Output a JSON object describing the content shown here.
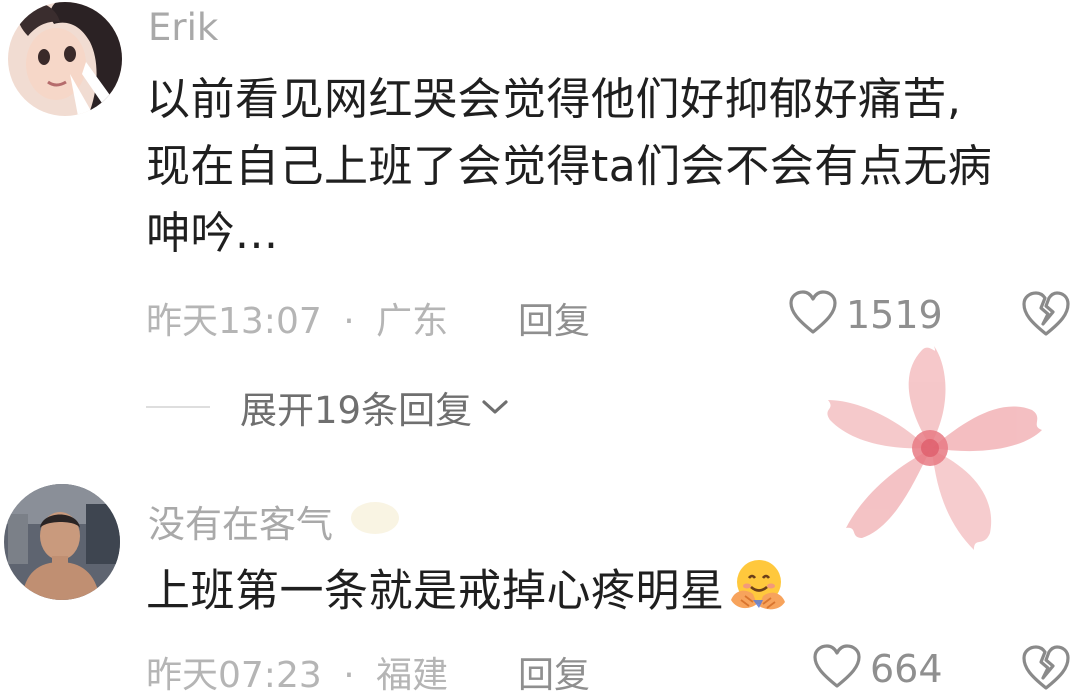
{
  "comments": [
    {
      "username": "Erik",
      "body_lines": [
        "以前看见网红哭会觉得他们好抑郁好痛苦,",
        "现在自己上班了会觉得ta们会不会有点无病",
        "呻吟..."
      ],
      "time": "昨天13:07",
      "separator": "·",
      "location": "广东",
      "reply_label": "回复",
      "likes": "1519"
    },
    {
      "username": "没有在客气",
      "body_lines": [
        "上班第一条就是戒掉心疼明星"
      ],
      "time": "昨天07:23",
      "separator": "·",
      "location": "福建",
      "reply_label": "回复",
      "likes": "664"
    }
  ],
  "expand_replies": {
    "label": "展开19条回复"
  },
  "icons": {
    "like": "heart-outline-icon",
    "dislike": "broken-heart-icon",
    "expand": "chevron-down-icon",
    "hug_emoji": "hugging-face-emoji",
    "decoration": "cherry-blossom-sticker"
  },
  "colors": {
    "username": "#a9a9a9",
    "body": "#1f1f1f",
    "meta": "#b5b5b5",
    "action": "#8f8f8f",
    "blossom": "#f4b9bd"
  }
}
